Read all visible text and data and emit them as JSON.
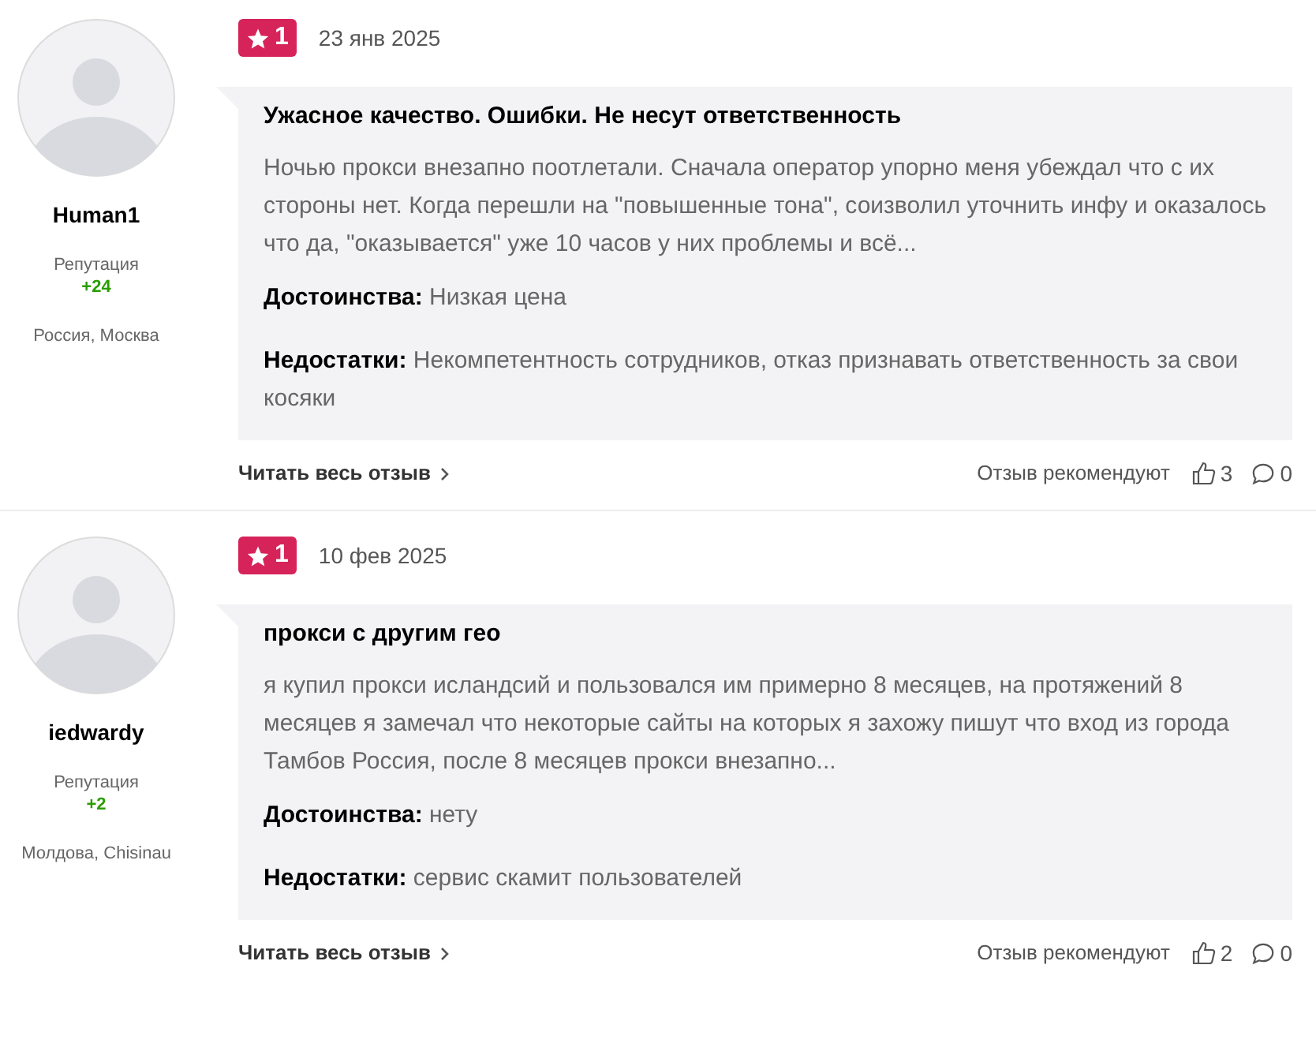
{
  "reviews": [
    {
      "author": "Human1",
      "reputation_label": "Репутация",
      "reputation": "+24",
      "location": "Россия, Москва",
      "rating": "1",
      "date": "23 янв 2025",
      "title": "Ужасное качество. Ошибки. Не несут ответственность",
      "text": "Ночью прокси внезапно поотлетали. Сначала оператор упорно меня убеждал что с их стороны нет. Когда перешли на \"повышенные тона\", соизволил уточнить инфу и оказалось что да, \"оказывается\" уже 10 часов у них проблемы и всё...",
      "pros_label": "Достоинства:",
      "pros": "Низкая цена",
      "cons_label": "Недостатки:",
      "cons": "Некомпетентность сотрудников, отказ признавать ответственность за свои косяки",
      "read_more": "Читать весь отзыв",
      "recommend_label": "Отзыв рекомендуют",
      "likes": "3",
      "comments": "0"
    },
    {
      "author": "iedwardy",
      "reputation_label": "Репутация",
      "reputation": "+2",
      "location": "Молдова, Chisinau",
      "rating": "1",
      "date": "10 фев 2025",
      "title": "прокси с другим гео",
      "text": "я купил прокси исландсий и пользовался им примерно 8 месяцев, на протяжений 8 месяцев я замечал что некоторые сайты на которых я захожу пишут что вход из города Тамбов Россия, после 8 месяцев прокси внезапно...",
      "pros_label": "Достоинства:",
      "pros": "нету",
      "cons_label": "Недостатки:",
      "cons": "сервис скамит пользователей",
      "read_more": "Читать весь отзыв",
      "recommend_label": "Отзыв рекомендуют",
      "likes": "2",
      "comments": "0"
    }
  ]
}
